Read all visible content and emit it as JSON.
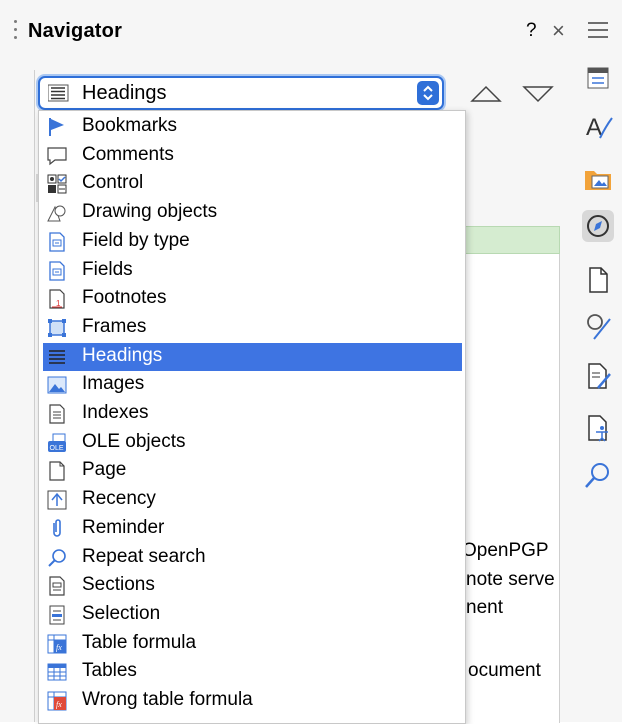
{
  "navigator": {
    "title": "Navigator",
    "help_label": "?",
    "close_label": "×"
  },
  "combo": {
    "selected": "Headings"
  },
  "dropdown": {
    "items": [
      {
        "label": "Bookmarks",
        "icon": "bookmark-flag-icon"
      },
      {
        "label": "Comments",
        "icon": "comment-bubble-icon"
      },
      {
        "label": "Control",
        "icon": "control-icon"
      },
      {
        "label": "Drawing objects",
        "icon": "drawing-objects-icon"
      },
      {
        "label": "Field by type",
        "icon": "field-by-type-icon"
      },
      {
        "label": "Fields",
        "icon": "fields-icon"
      },
      {
        "label": "Footnotes",
        "icon": "footnotes-icon"
      },
      {
        "label": "Frames",
        "icon": "frames-icon"
      },
      {
        "label": "Headings",
        "icon": "headings-icon",
        "selected": true
      },
      {
        "label": "Images",
        "icon": "images-icon"
      },
      {
        "label": "Indexes",
        "icon": "indexes-icon"
      },
      {
        "label": "OLE objects",
        "icon": "ole-objects-icon"
      },
      {
        "label": "Page",
        "icon": "page-icon"
      },
      {
        "label": "Recency",
        "icon": "recency-icon"
      },
      {
        "label": "Reminder",
        "icon": "reminder-clip-icon"
      },
      {
        "label": "Repeat search",
        "icon": "repeat-search-icon"
      },
      {
        "label": "Sections",
        "icon": "sections-icon"
      },
      {
        "label": "Selection",
        "icon": "selection-icon"
      },
      {
        "label": "Table formula",
        "icon": "table-formula-icon"
      },
      {
        "label": "Tables",
        "icon": "tables-icon"
      },
      {
        "label": "Wrong table formula",
        "icon": "wrong-table-formula-icon"
      }
    ]
  },
  "background_text": {
    "line1": "OpenPGP",
    "line2": "note serve",
    "line3": "nent",
    "line4": "ocument"
  },
  "sidebar": {
    "icons": [
      "properties-icon",
      "styles-icon",
      "gallery-icon",
      "navigator-icon",
      "page-icon",
      "style-inspector-icon",
      "manage-changes-icon",
      "accessibility-check-icon",
      "find-icon"
    ],
    "active": "navigator-icon"
  },
  "colors": {
    "accent": "#3e74e2",
    "selection": "#3e74e2",
    "green_row": "#d5ecd0"
  }
}
